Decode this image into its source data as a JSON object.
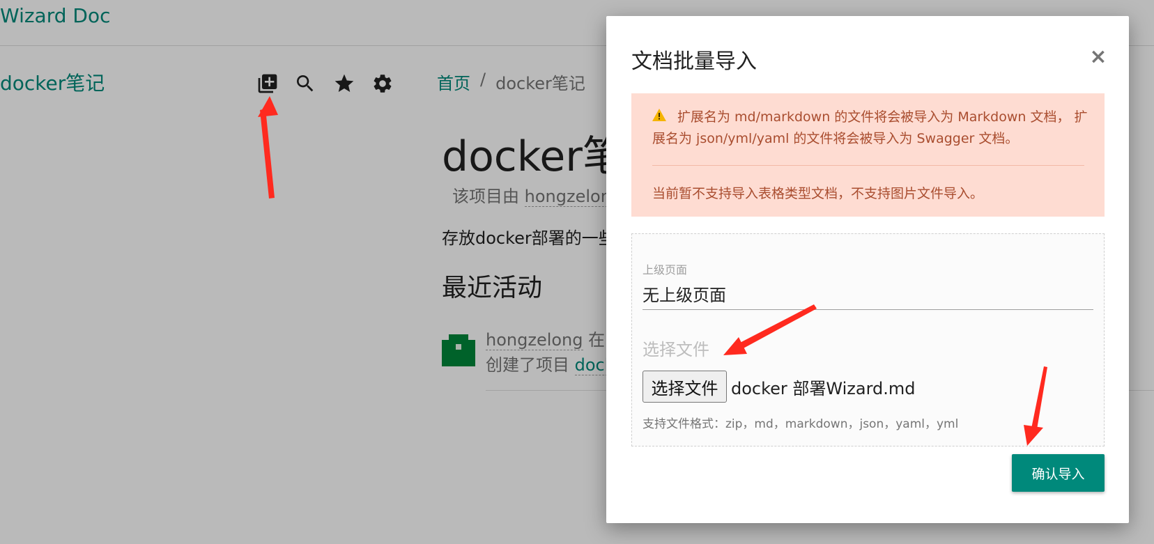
{
  "app": {
    "brand": "Wizard Doc"
  },
  "sidebar": {
    "project_name": "docker笔记",
    "toolbar_icons": [
      "add-box-icon",
      "search-icon",
      "star-icon",
      "gear-icon"
    ]
  },
  "breadcrumb": {
    "home": "首页",
    "separator": "/",
    "current": "docker笔记"
  },
  "doc": {
    "title": "docker笔",
    "owner_prefix": "该项目由",
    "owner_user": "hongzelong",
    "description": "存放docker部署的一些",
    "recent_heading": "最近活动",
    "activity": {
      "user": "hongzelong",
      "user_suffix": " 在 ",
      "action_prefix": "创建了项目 ",
      "link": "dock"
    }
  },
  "modal": {
    "title": "文档批量导入",
    "close": "×",
    "alert": {
      "icon": "warning-icon",
      "line1": "扩展名为 md/markdown 的文件将会被导入为 Markdown 文档， 扩展名为 json/yml/yaml 的文件将会被导入为 Swagger 文档。",
      "line2": "当前暂不支持导入表格类型文档，不支持图片文件导入。"
    },
    "parent_label": "上级页面",
    "parent_value": "无上级页面",
    "file_label": "选择文件",
    "file_button": "选择文件",
    "file_name": "docker 部署Wizard.md",
    "file_help": "支持文件格式：zip，md，markdown，json，yaml，yml",
    "confirm": "确认导入"
  },
  "colors": {
    "accent": "#00897b",
    "alert_bg": "#fedcd2",
    "alert_text": "#a94d2f",
    "annotation": "#ff2a1f"
  }
}
